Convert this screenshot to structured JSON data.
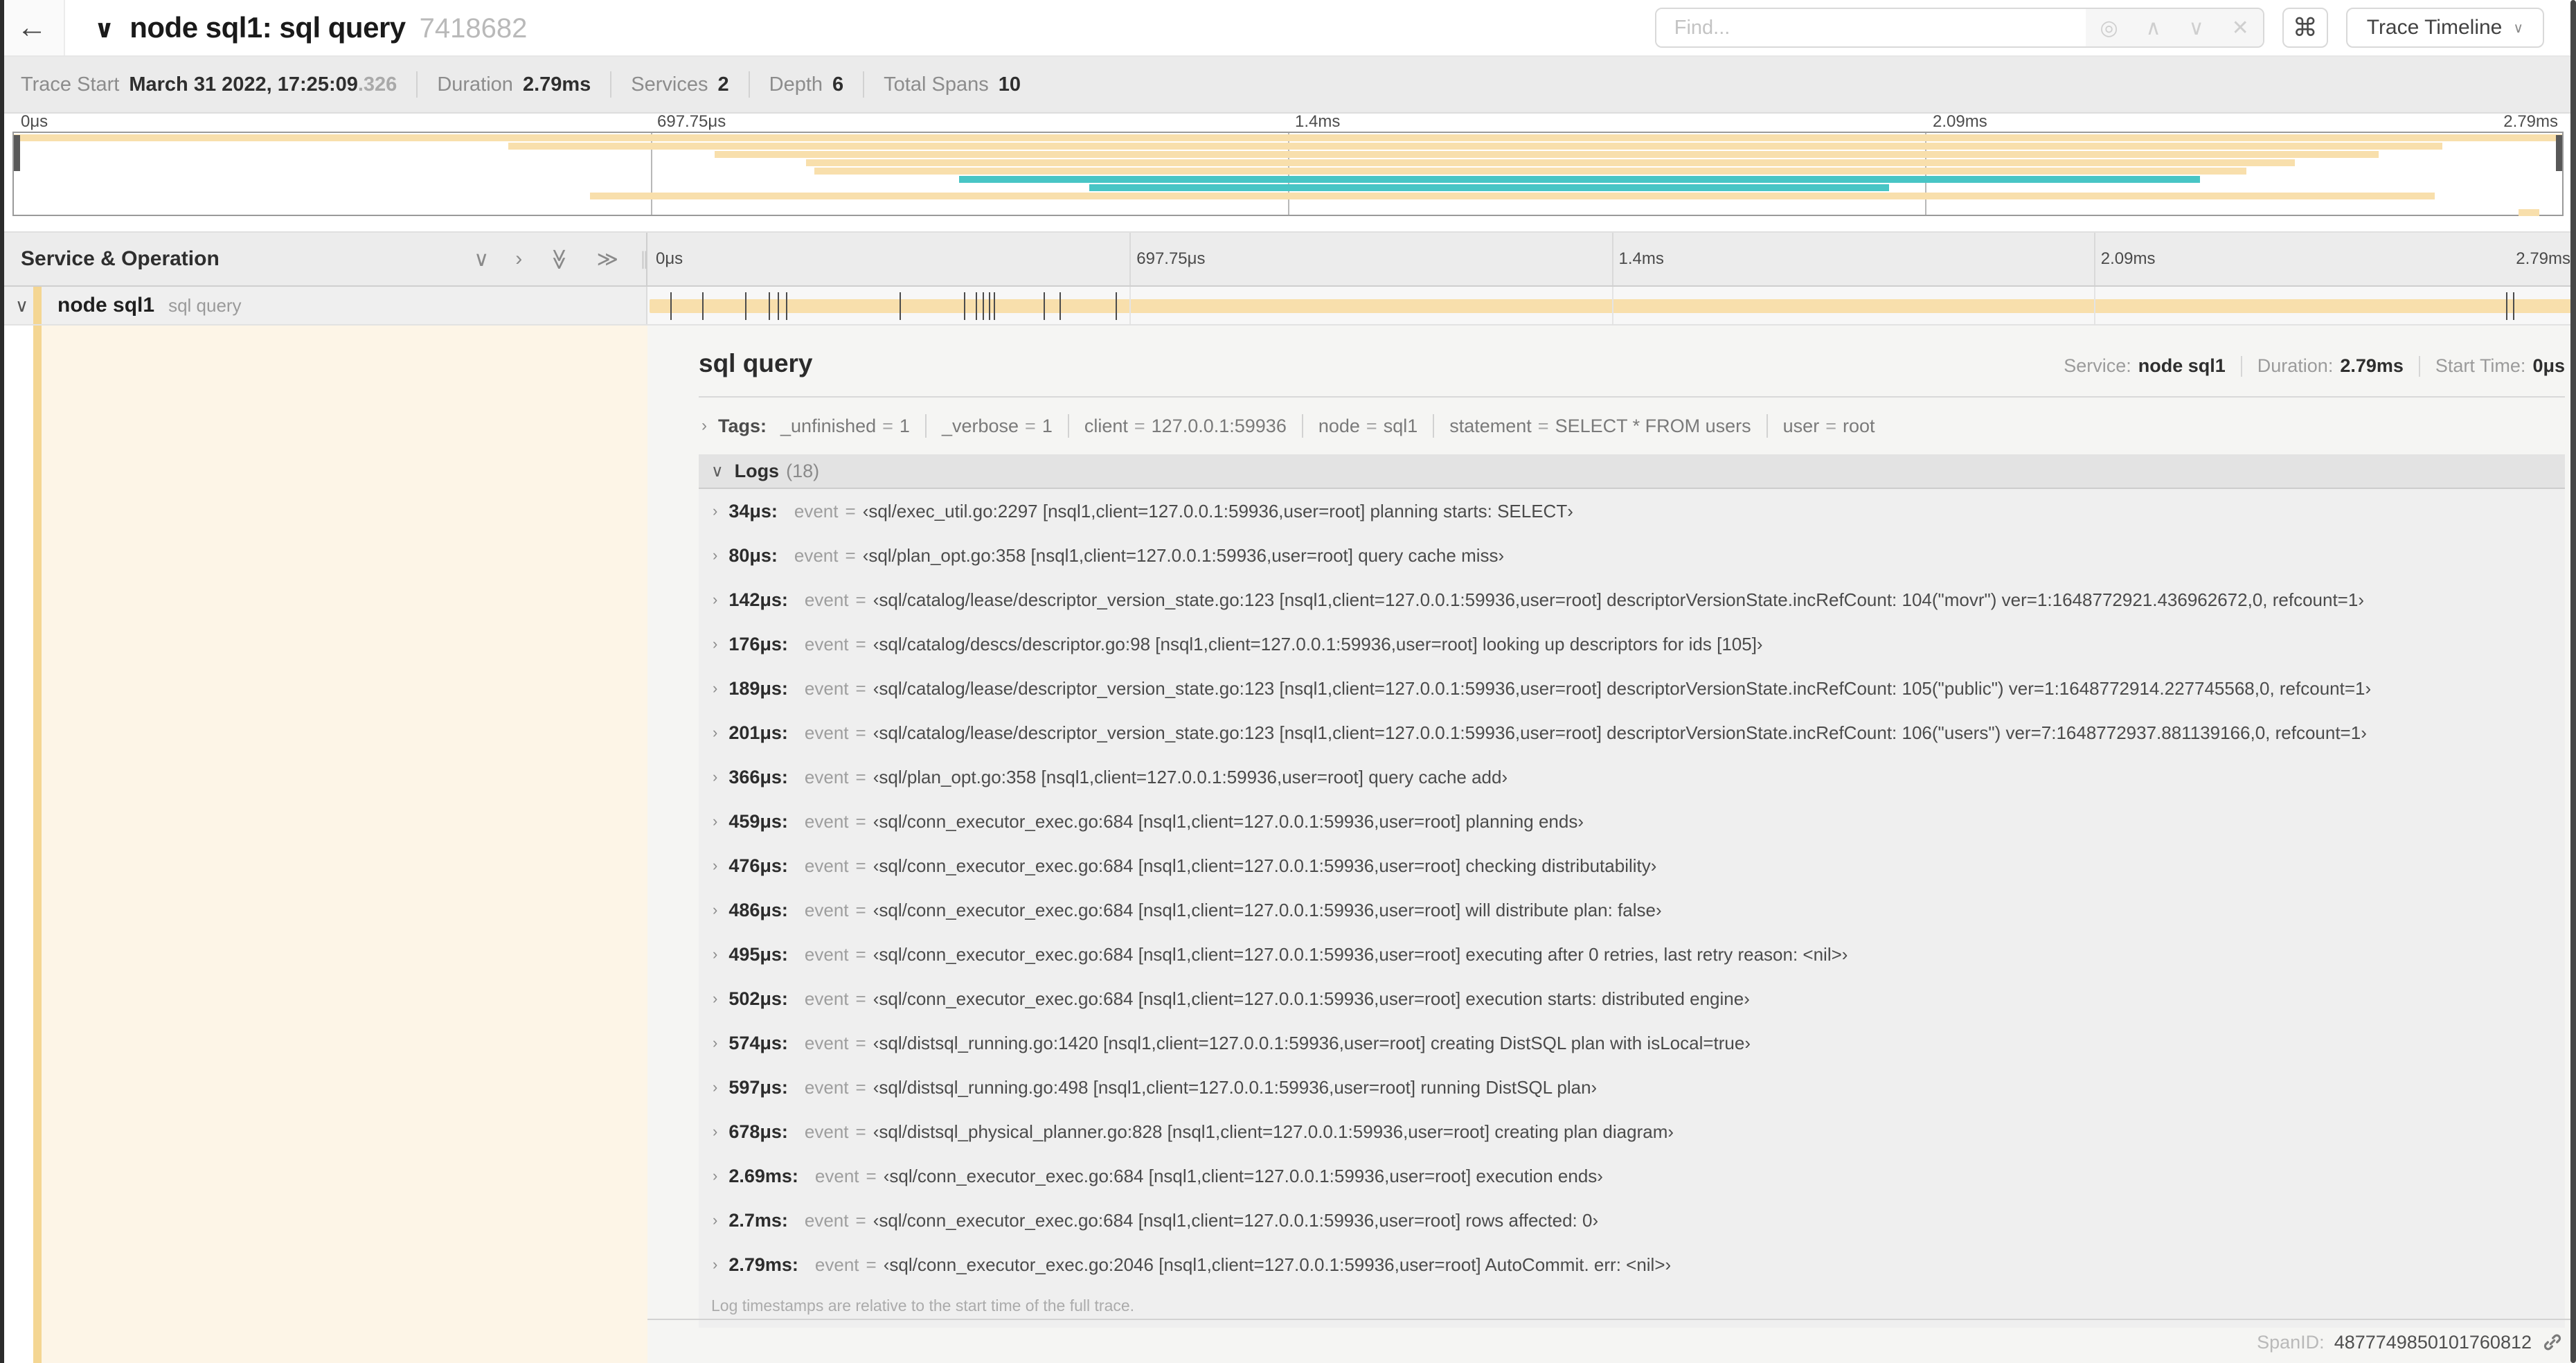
{
  "header": {
    "back_icon": "←",
    "collapse_chevron": "∨",
    "title": "node sql1: sql query",
    "trace_id": "7418682",
    "find": {
      "placeholder": "Find...",
      "match_icon": "◎",
      "prev_icon": "∧",
      "next_icon": "∨",
      "clear_icon": "✕"
    },
    "shortcuts_icon": "⌘",
    "view_dropdown": {
      "label": "Trace Timeline",
      "chevron": "∨"
    }
  },
  "summary": {
    "items": [
      {
        "label": "Trace Start",
        "value": "March 31 2022, 17:25:09",
        "suffix": ".326"
      },
      {
        "label": "Duration",
        "value": "2.79ms"
      },
      {
        "label": "Services",
        "value": "2"
      },
      {
        "label": "Depth",
        "value": "6"
      },
      {
        "label": "Total Spans",
        "value": "10"
      }
    ]
  },
  "colors": {
    "tan": "#F8DFAC",
    "teal": "#48C5C5",
    "strip": "#F4D693",
    "cream": "#FDF5E7"
  },
  "minimap": {
    "ticks": [
      {
        "label": "0μs",
        "pct": 0
      },
      {
        "label": "697.75μs",
        "pct": 25
      },
      {
        "label": "1.4ms",
        "pct": 50
      },
      {
        "label": "2.09ms",
        "pct": 75
      },
      {
        "label": "2.79ms",
        "pct": 100
      }
    ],
    "bars": [
      {
        "row": 0,
        "start": 0,
        "end": 100,
        "color": "tan"
      },
      {
        "row": 1,
        "start": 19.4,
        "end": 95.3,
        "color": "tan"
      },
      {
        "row": 2,
        "start": 27.5,
        "end": 92.8,
        "color": "tan"
      },
      {
        "row": 3,
        "start": 31.1,
        "end": 89.5,
        "color": "tan"
      },
      {
        "row": 4,
        "start": 31.4,
        "end": 87.6,
        "color": "tan"
      },
      {
        "row": 5,
        "start": 37.1,
        "end": 85.8,
        "color": "teal"
      },
      {
        "row": 6,
        "start": 42.2,
        "end": 73.6,
        "color": "teal"
      },
      {
        "row": 7,
        "start": 22.6,
        "end": 95.0,
        "color": "tan"
      },
      {
        "row": 9,
        "start": 98.3,
        "end": 99.1,
        "color": "tan"
      }
    ]
  },
  "timeline": {
    "left_header": "Service & Operation",
    "icons": {
      "collapse_one": "∨",
      "expand_one": "›",
      "collapse_all": "≫",
      "expand_all": "≫",
      "handle": "∥"
    },
    "row": {
      "expander": "∨",
      "service": "node sql1",
      "operation": "sql query",
      "log_markers": [
        1.22,
        2.87,
        5.09,
        6.31,
        6.77,
        7.2,
        13.12,
        16.45,
        17.06,
        17.42,
        17.74,
        18.0,
        20.57,
        21.4,
        24.3,
        96.42,
        96.77,
        99.85
      ]
    }
  },
  "detail": {
    "title": "sql query",
    "stats": [
      {
        "label": "Service:",
        "value": "node sql1"
      },
      {
        "label": "Duration:",
        "value": "2.79ms"
      },
      {
        "label": "Start Time:",
        "value": "0μs"
      }
    ],
    "tags": {
      "chevron": "›",
      "label": "Tags:",
      "eq": "=",
      "items": [
        {
          "key": "_unfinished",
          "value": "1"
        },
        {
          "key": "_verbose",
          "value": "1"
        },
        {
          "key": "client",
          "value": "127.0.0.1:59936"
        },
        {
          "key": "node",
          "value": "sql1"
        },
        {
          "key": "statement",
          "value": "SELECT * FROM users"
        },
        {
          "key": "user",
          "value": "root"
        }
      ]
    },
    "logs": {
      "chevron": "∨",
      "label": "Logs",
      "count": "(18)",
      "row_chevron": "›",
      "eq": "=",
      "entries": [
        {
          "ts": "34μs:",
          "key": "event",
          "value": "‹sql/exec_util.go:2297 [nsql1,client=127.0.0.1:59936,user=root] planning starts: SELECT›"
        },
        {
          "ts": "80μs:",
          "key": "event",
          "value": "‹sql/plan_opt.go:358 [nsql1,client=127.0.0.1:59936,user=root] query cache miss›"
        },
        {
          "ts": "142μs:",
          "key": "event",
          "value": "‹sql/catalog/lease/descriptor_version_state.go:123 [nsql1,client=127.0.0.1:59936,user=root] descriptorVersionState.incRefCount: 104(\"movr\") ver=1:1648772921.436962672,0, refcount=1›"
        },
        {
          "ts": "176μs:",
          "key": "event",
          "value": "‹sql/catalog/descs/descriptor.go:98 [nsql1,client=127.0.0.1:59936,user=root] looking up descriptors for ids [105]›"
        },
        {
          "ts": "189μs:",
          "key": "event",
          "value": "‹sql/catalog/lease/descriptor_version_state.go:123 [nsql1,client=127.0.0.1:59936,user=root] descriptorVersionState.incRefCount: 105(\"public\") ver=1:1648772914.227745568,0, refcount=1›"
        },
        {
          "ts": "201μs:",
          "key": "event",
          "value": "‹sql/catalog/lease/descriptor_version_state.go:123 [nsql1,client=127.0.0.1:59936,user=root] descriptorVersionState.incRefCount: 106(\"users\") ver=7:1648772937.881139166,0, refcount=1›"
        },
        {
          "ts": "366μs:",
          "key": "event",
          "value": "‹sql/plan_opt.go:358 [nsql1,client=127.0.0.1:59936,user=root] query cache add›"
        },
        {
          "ts": "459μs:",
          "key": "event",
          "value": "‹sql/conn_executor_exec.go:684 [nsql1,client=127.0.0.1:59936,user=root] planning ends›"
        },
        {
          "ts": "476μs:",
          "key": "event",
          "value": "‹sql/conn_executor_exec.go:684 [nsql1,client=127.0.0.1:59936,user=root] checking distributability›"
        },
        {
          "ts": "486μs:",
          "key": "event",
          "value": "‹sql/conn_executor_exec.go:684 [nsql1,client=127.0.0.1:59936,user=root] will distribute plan: false›"
        },
        {
          "ts": "495μs:",
          "key": "event",
          "value": "‹sql/conn_executor_exec.go:684 [nsql1,client=127.0.0.1:59936,user=root] executing after 0 retries, last retry reason: <nil>›"
        },
        {
          "ts": "502μs:",
          "key": "event",
          "value": "‹sql/conn_executor_exec.go:684 [nsql1,client=127.0.0.1:59936,user=root] execution starts: distributed engine›"
        },
        {
          "ts": "574μs:",
          "key": "event",
          "value": "‹sql/distsql_running.go:1420 [nsql1,client=127.0.0.1:59936,user=root] creating DistSQL plan with isLocal=true›"
        },
        {
          "ts": "597μs:",
          "key": "event",
          "value": "‹sql/distsql_running.go:498 [nsql1,client=127.0.0.1:59936,user=root] running DistSQL plan›"
        },
        {
          "ts": "678μs:",
          "key": "event",
          "value": "‹sql/distsql_physical_planner.go:828 [nsql1,client=127.0.0.1:59936,user=root] creating plan diagram›"
        },
        {
          "ts": "2.69ms:",
          "key": "event",
          "value": "‹sql/conn_executor_exec.go:684 [nsql1,client=127.0.0.1:59936,user=root] execution ends›"
        },
        {
          "ts": "2.7ms:",
          "key": "event",
          "value": "‹sql/conn_executor_exec.go:684 [nsql1,client=127.0.0.1:59936,user=root] rows affected: 0›"
        },
        {
          "ts": "2.79ms:",
          "key": "event",
          "value": "‹sql/conn_executor_exec.go:2046 [nsql1,client=127.0.0.1:59936,user=root] AutoCommit. err: <nil>›"
        }
      ],
      "footer": "Log timestamps are relative to the start time of the full trace."
    },
    "footer": {
      "span_id_label": "SpanID:",
      "span_id": "4877749850101760812"
    }
  }
}
